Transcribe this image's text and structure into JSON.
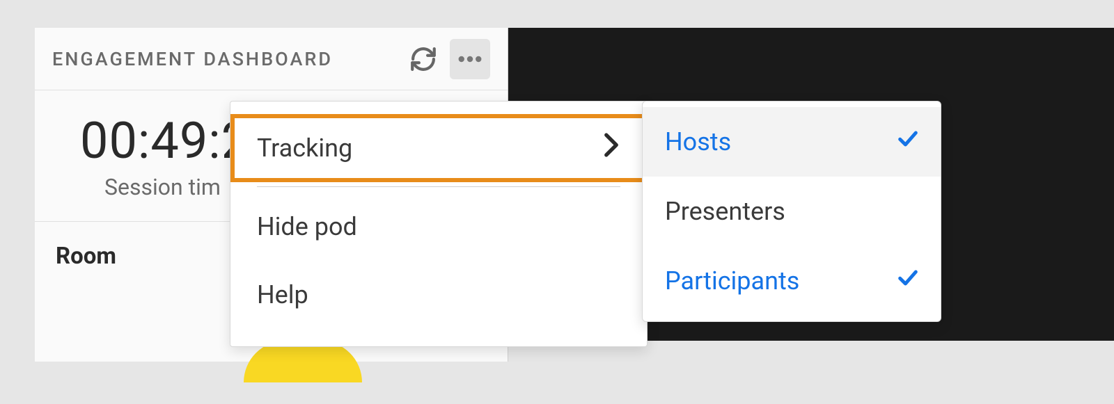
{
  "pod": {
    "title": "ENGAGEMENT DASHBOARD",
    "timer_value": "00:49:2",
    "timer_label": "Session tim",
    "room_label": "Room"
  },
  "menu": {
    "tracking": "Tracking",
    "hide_pod": "Hide pod",
    "help": "Help"
  },
  "submenu": {
    "hosts": "Hosts",
    "presenters": "Presenters",
    "participants": "Participants"
  },
  "colors": {
    "accent": "#1473e6",
    "highlight": "#e88c1a"
  }
}
